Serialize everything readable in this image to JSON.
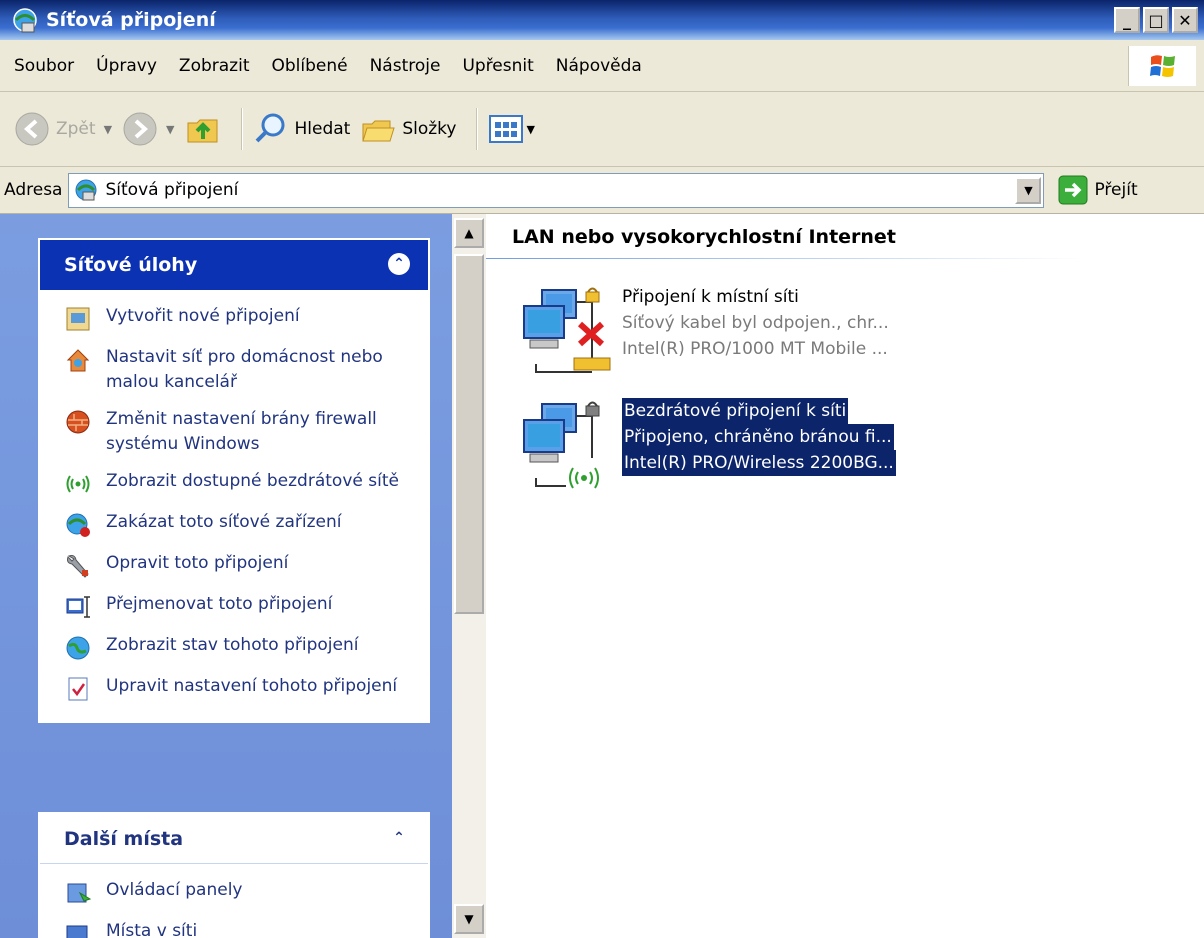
{
  "window": {
    "title": "Síťová připojení"
  },
  "menu": [
    "Soubor",
    "Úpravy",
    "Zobrazit",
    "Oblíbené",
    "Nástroje",
    "Upřesnit",
    "Nápověda"
  ],
  "toolbar": {
    "back": "Zpět",
    "search": "Hledat",
    "folders": "Složky"
  },
  "address": {
    "label": "Adresa",
    "value": "Síťová připojení",
    "go": "Přejít"
  },
  "tasks_panel": {
    "title": "Síťové úlohy",
    "items": [
      "Vytvořit nové připojení",
      "Nastavit síť pro domácnost nebo malou kancelář",
      "Změnit nastavení brány firewall systému Windows",
      "Zobrazit dostupné bezdrátové sítě",
      "Zakázat toto síťové zařízení",
      "Opravit toto připojení",
      "Přejmenovat toto připojení",
      "Zobrazit stav tohoto připojení",
      "Upravit nastavení tohoto připojení"
    ]
  },
  "places_panel": {
    "title": "Další místa",
    "items": [
      "Ovládací panely",
      "Místa v síti"
    ]
  },
  "content": {
    "group": "LAN nebo vysokorychlostní Internet",
    "connections": [
      {
        "name": "Připojení k místní síti",
        "status": "Síťový kabel byl odpojen., chr...",
        "device": "Intel(R) PRO/1000 MT Mobile ..."
      },
      {
        "name": "Bezdrátové připojení k síti",
        "status": "Připojeno, chráněno bránou fi...",
        "device": "Intel(R) PRO/Wireless 2200BG..."
      }
    ]
  },
  "colors": {
    "titlebar": "#0a246a",
    "task_header": "#0c32b4",
    "task_pane_bg": "#6e8fd8",
    "selection": "#0c246a"
  }
}
